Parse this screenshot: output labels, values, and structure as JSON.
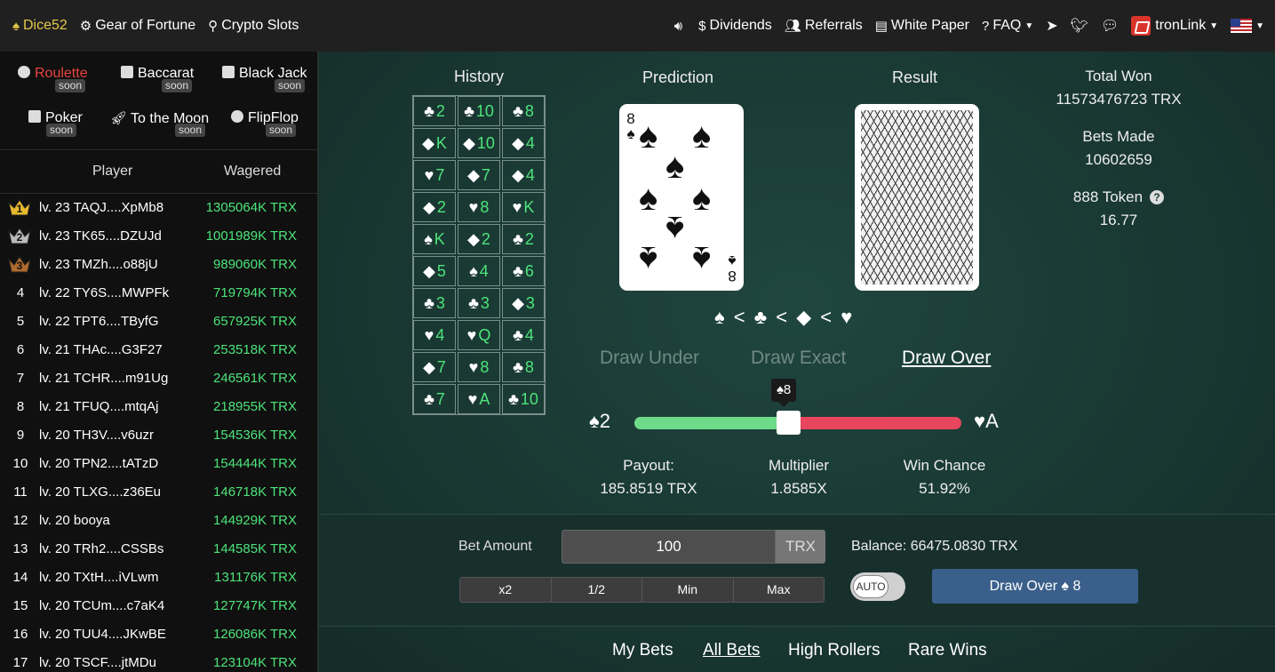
{
  "nav": {
    "brand": "Dice52",
    "gear": "Gear of Fortune",
    "slots": "Crypto Slots",
    "dividends": "Dividends",
    "referrals": "Referrals",
    "whitepaper": "White Paper",
    "faq": "FAQ",
    "wallet": "tronLink"
  },
  "games": [
    {
      "label": "Roulette",
      "soon": "soon"
    },
    {
      "label": "Baccarat",
      "soon": "soon"
    },
    {
      "label": "Black Jack",
      "soon": "soon"
    },
    {
      "label": "Poker",
      "soon": "soon"
    },
    {
      "label": "To the Moon",
      "soon": "soon"
    },
    {
      "label": "FlipFlop",
      "soon": "soon"
    }
  ],
  "leaderboard": {
    "player_header": "Player",
    "wagered_header": "Wagered",
    "rows": [
      {
        "rank": "1",
        "player": "lv. 23 TAQJ....XpMb8",
        "wagered": "1305064K TRX"
      },
      {
        "rank": "2",
        "player": "lv. 23 TK65....DZUJd",
        "wagered": "1001989K TRX"
      },
      {
        "rank": "3",
        "player": "lv. 23 TMZh....o88jU",
        "wagered": "989060K TRX"
      },
      {
        "rank": "4",
        "player": "lv. 22 TY6S....MWPFk",
        "wagered": "719794K TRX"
      },
      {
        "rank": "5",
        "player": "lv. 22 TPT6....TByfG",
        "wagered": "657925K TRX"
      },
      {
        "rank": "6",
        "player": "lv. 21 THAc....G3F27",
        "wagered": "253518K TRX"
      },
      {
        "rank": "7",
        "player": "lv. 21 TCHR....m91Ug",
        "wagered": "246561K TRX"
      },
      {
        "rank": "8",
        "player": "lv. 21 TFUQ....mtqAj",
        "wagered": "218955K TRX"
      },
      {
        "rank": "9",
        "player": "lv. 20 TH3V....v6uzr",
        "wagered": "154536K TRX"
      },
      {
        "rank": "10",
        "player": "lv. 20 TPN2....tATzD",
        "wagered": "154444K TRX"
      },
      {
        "rank": "11",
        "player": "lv. 20 TLXG....z36Eu",
        "wagered": "146718K TRX"
      },
      {
        "rank": "12",
        "player": "lv. 20 booya",
        "wagered": "144929K TRX"
      },
      {
        "rank": "13",
        "player": "lv. 20 TRh2....CSSBs",
        "wagered": "144585K TRX"
      },
      {
        "rank": "14",
        "player": "lv. 20 TXtH....iVLwm",
        "wagered": "131176K TRX"
      },
      {
        "rank": "15",
        "player": "lv. 20 TCUm....c7aK4",
        "wagered": "127747K TRX"
      },
      {
        "rank": "16",
        "player": "lv. 20 TUU4....JKwBE",
        "wagered": "126086K TRX"
      },
      {
        "rank": "17",
        "player": "lv. 20 TSCF....jtMDu",
        "wagered": "123104K TRX"
      }
    ]
  },
  "history": {
    "title": "History",
    "cells": [
      {
        "suit": "♣",
        "rank": "2"
      },
      {
        "suit": "♣",
        "rank": "10"
      },
      {
        "suit": "♣",
        "rank": "8"
      },
      {
        "suit": "◆",
        "rank": "K"
      },
      {
        "suit": "◆",
        "rank": "10"
      },
      {
        "suit": "◆",
        "rank": "4"
      },
      {
        "suit": "♥",
        "rank": "7"
      },
      {
        "suit": "◆",
        "rank": "7"
      },
      {
        "suit": "◆",
        "rank": "4"
      },
      {
        "suit": "◆",
        "rank": "2"
      },
      {
        "suit": "♥",
        "rank": "8"
      },
      {
        "suit": "♥",
        "rank": "K"
      },
      {
        "suit": "♠",
        "rank": "K"
      },
      {
        "suit": "◆",
        "rank": "2"
      },
      {
        "suit": "♣",
        "rank": "2"
      },
      {
        "suit": "◆",
        "rank": "5"
      },
      {
        "suit": "♠",
        "rank": "4"
      },
      {
        "suit": "♣",
        "rank": "6"
      },
      {
        "suit": "♣",
        "rank": "3"
      },
      {
        "suit": "♣",
        "rank": "3"
      },
      {
        "suit": "◆",
        "rank": "3"
      },
      {
        "suit": "♥",
        "rank": "4"
      },
      {
        "suit": "♥",
        "rank": "Q"
      },
      {
        "suit": "♣",
        "rank": "4"
      },
      {
        "suit": "◆",
        "rank": "7"
      },
      {
        "suit": "♥",
        "rank": "8"
      },
      {
        "suit": "♣",
        "rank": "8"
      },
      {
        "suit": "♣",
        "rank": "7"
      },
      {
        "suit": "♥",
        "rank": "A"
      },
      {
        "suit": "♣",
        "rank": "10"
      }
    ]
  },
  "prediction": {
    "title": "Prediction",
    "card_rank": "8",
    "card_suit": "♠"
  },
  "result": {
    "title": "Result"
  },
  "suit_order": "♠ < ♣ < ◆ < ♥",
  "draw_options": {
    "under": "Draw Under",
    "exact": "Draw Exact",
    "over": "Draw Over"
  },
  "slider": {
    "min_label": "♠2",
    "max_label": "♥A",
    "tooltip": "♠8",
    "value_fraction": 0.47
  },
  "stats": {
    "payout_label": "Payout:",
    "payout_value": "185.8519 TRX",
    "multiplier_label": "Multiplier",
    "multiplier_value": "1.8585X",
    "winchance_label": "Win Chance",
    "winchance_value": "51.92%"
  },
  "totals": {
    "total_won_label": "Total Won",
    "total_won_value": "11573476723 TRX",
    "bets_made_label": "Bets Made",
    "bets_made_value": "10602659",
    "token_label": "888 Token",
    "token_value": "16.77"
  },
  "bet": {
    "label": "Bet Amount",
    "amount": "100",
    "unit": "TRX",
    "balance": "Balance: 66475.0830 TRX",
    "quick": [
      "x2",
      "1/2",
      "Min",
      "Max"
    ],
    "auto": "AUTO",
    "draw_button": "Draw Over ♠ 8"
  },
  "tabs": [
    "My Bets",
    "All Bets",
    "High Rollers",
    "Rare Wins"
  ],
  "colors": {
    "accent_green": "#4de47a",
    "slider_red": "#e8465e",
    "brand_gold": "#e4c64a",
    "button_blue": "#3a5f8a"
  }
}
